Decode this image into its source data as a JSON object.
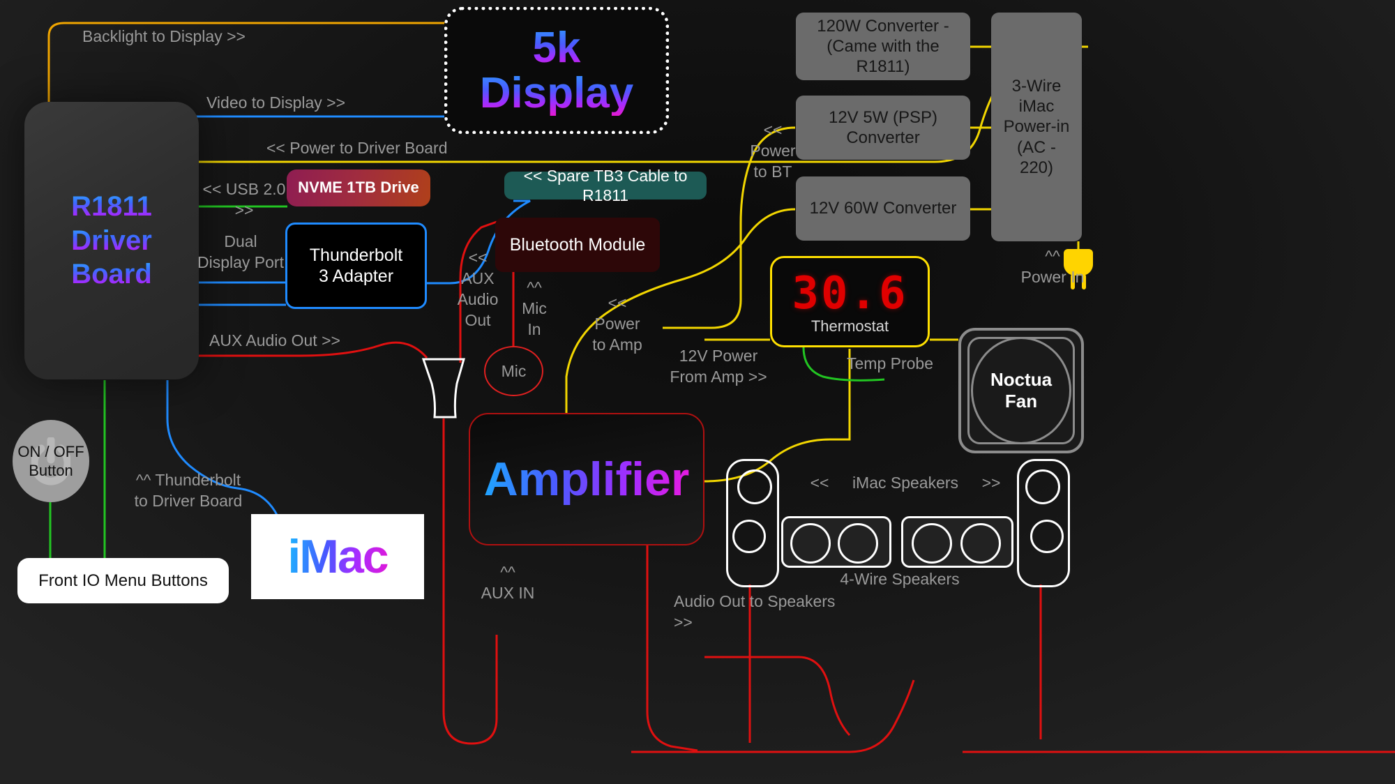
{
  "theme": {
    "background": "#1a1a1a",
    "wire_yellow": "#f2d600",
    "wire_blue": "#1f8bff",
    "wire_red": "#e01010",
    "wire_green": "#22c522",
    "wire_orange": "#f0a500",
    "label_grey": "#9a9a9a"
  },
  "nodes": {
    "driver_board": {
      "line1": "R1811",
      "line2": "Driver",
      "line3": "Board"
    },
    "display": {
      "line1": "5k",
      "line2": "Display"
    },
    "nvme": {
      "label": "NVME 1TB Drive"
    },
    "tb3_badge": {
      "label": "<< Spare TB3 Cable  to R1811"
    },
    "tb_adapter": {
      "line1": "Thunderbolt",
      "line2": "3 Adapter"
    },
    "bluetooth": {
      "label": "Bluetooth Module"
    },
    "thermostat": {
      "value": "30.6",
      "label": "Thermostat"
    },
    "converter_120w": {
      "line1": "120W Converter -",
      "line2": "(Came with the R1811)"
    },
    "converter_12v5w": {
      "label": "12V 5W (PSP) Converter"
    },
    "converter_12v60w": {
      "label": "12V 60W Converter"
    },
    "power_in_box": {
      "line1": "3-Wire",
      "line2": "iMac",
      "line3": "Power-in",
      "line4": "(AC - 220)"
    },
    "noctua_fan": {
      "line1": "Noctua",
      "line2": "Fan"
    },
    "amplifier": {
      "label": "Amplifier"
    },
    "imac_logo": {
      "label": "iMac"
    },
    "front_io": {
      "label": "Front IO Menu Buttons"
    },
    "onoff_button": {
      "line1": "ON / OFF",
      "line2": "Button"
    },
    "mic": {
      "label": "Mic"
    }
  },
  "labels": {
    "backlight_to_display": "Backlight to Display >>",
    "video_to_display": "Video to Display >>",
    "power_to_driver_board": "<< Power to Driver Board",
    "usb_20": "<< USB 2.0 >>",
    "dual_display_port": "Dual\nDisplay Port",
    "aux_audio_out_left": "AUX Audio Out >>",
    "aux_audio_out_center": "<<\nAUX\nAudio\nOut",
    "mic_in": "^^\nMic\nIn",
    "power_to_bt": "<<\nPower\nto BT",
    "power_to_amp": "<<\nPower\nto Amp",
    "power_from_amp": "12V Power\nFrom  Amp >>",
    "temp_probe": "Temp Probe",
    "power_in": "^^\nPower In",
    "thunderbolt_to_driver_board": "^^ Thunderbolt\nto Driver Board",
    "aux_in": "^^\nAUX IN",
    "audio_out_to_speakers": "Audio Out to Speakers >>",
    "imac_speakers_left": "<<",
    "imac_speakers": "iMac Speakers",
    "imac_speakers_right": ">>",
    "four_wire_speakers": "4-Wire Speakers"
  }
}
